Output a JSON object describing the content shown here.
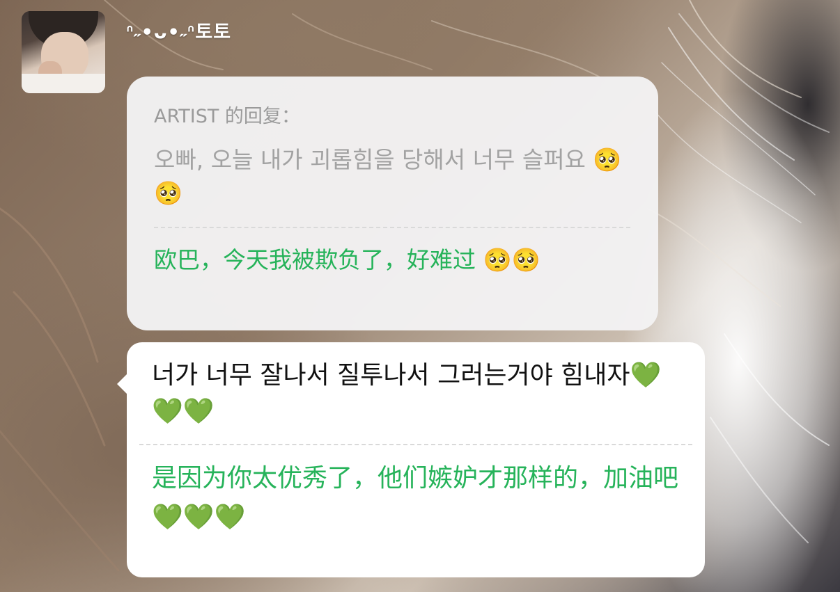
{
  "post": {
    "username": "ᐢ˶•ᴗ•˶ᐢ토토"
  },
  "quote_card": {
    "header": "ARTIST 的回复：",
    "original_ko": "오빠, 오늘 내가 괴롭힘을 당해서 너무 슬퍼요 🥺🥺",
    "translation_cn": "欧巴，今天我被欺负了，好难过 🥺🥺"
  },
  "reply_bubble": {
    "original_ko": "너가 너무 잘나서 질투나서 그러는거야 힘내자💚💚💚",
    "translation_cn": "是因为你太优秀了，他们嫉妒才那样的，加油吧💚💚💚"
  },
  "colors": {
    "translation_green": "#26b35a",
    "card_background": "#f3f2f3",
    "bubble_background": "#ffffff",
    "muted_text": "#a2a2a2"
  },
  "icons": {
    "pleading_face": "🥺",
    "green_heart": "💚"
  }
}
